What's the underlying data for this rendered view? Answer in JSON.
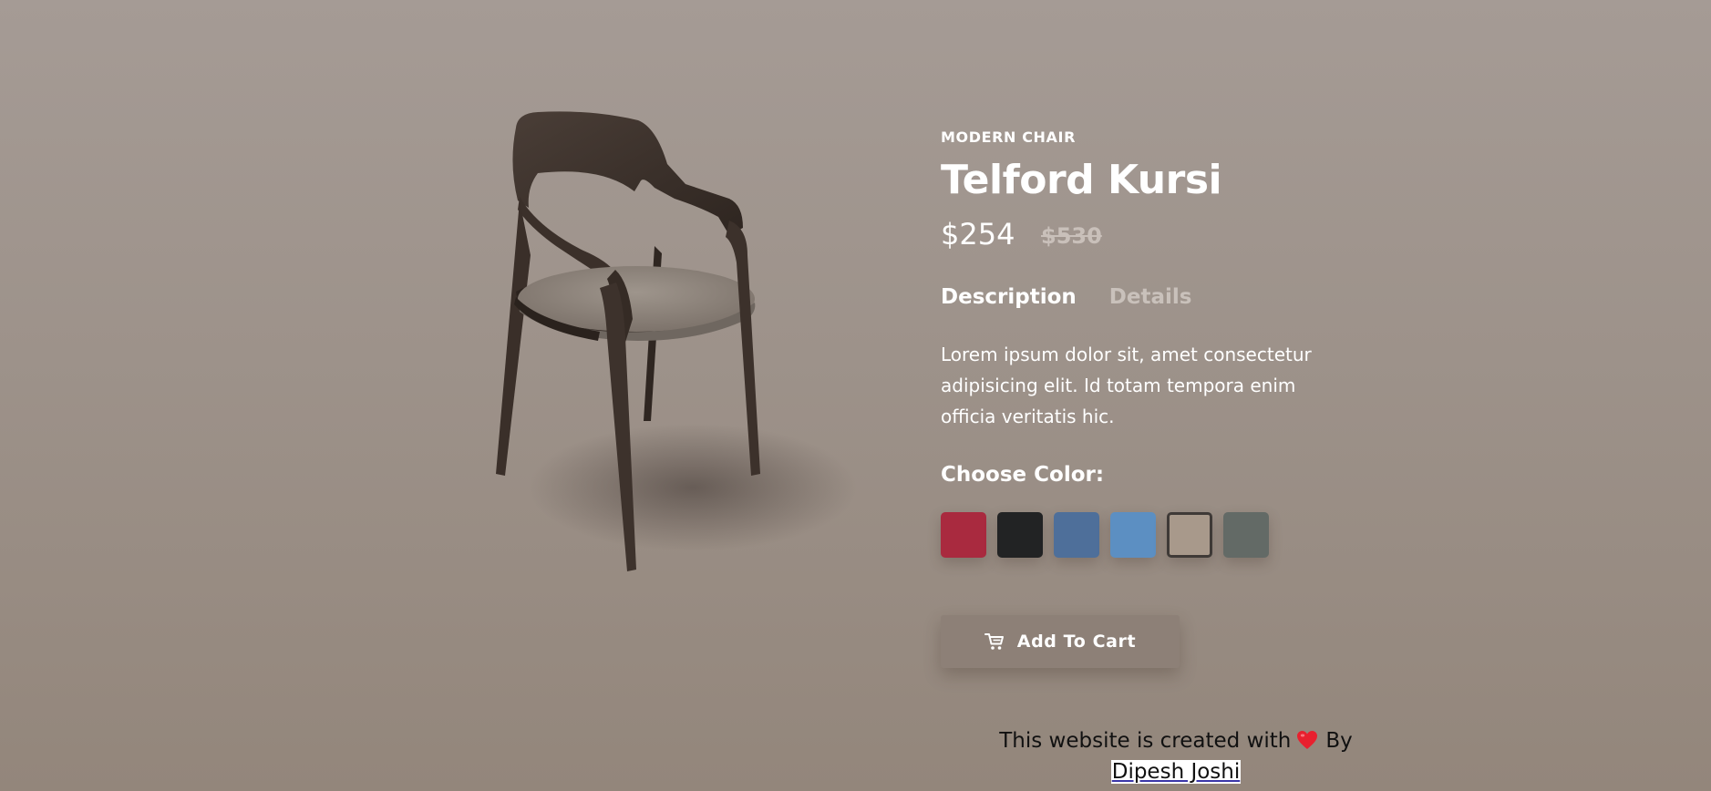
{
  "product": {
    "category": "MODERN CHAIR",
    "name": "Telford Kursi",
    "price": "$254",
    "old_price": "$530",
    "image_icon": "chair-image"
  },
  "tabs": [
    {
      "label": "Description",
      "active": true
    },
    {
      "label": "Details",
      "active": false
    }
  ],
  "description": "Lorem ipsum dolor sit, amet consectetur adipisicing elit. Id totam tempora enim officia veritatis hic.",
  "color_picker": {
    "label": "Choose Color:",
    "swatches": [
      {
        "color": "#a92a3f",
        "selected": false
      },
      {
        "color": "#222324",
        "selected": false
      },
      {
        "color": "#4e6f9a",
        "selected": false
      },
      {
        "color": "#5c8fc2",
        "selected": false
      },
      {
        "color": "#a8998b",
        "selected": true
      },
      {
        "color": "#636a66",
        "selected": false
      }
    ]
  },
  "cart": {
    "label": "Add To Cart",
    "icon": "cart-icon"
  },
  "footer": {
    "text": "This website is created with",
    "icon": "heart-icon",
    "by": "By",
    "author": "Dipesh Joshi"
  }
}
